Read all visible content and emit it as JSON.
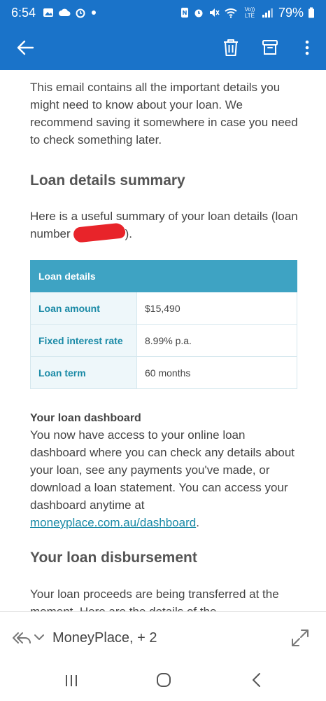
{
  "status_bar": {
    "time": "6:54",
    "left_icons": [
      "gallery-icon",
      "cloud-icon",
      "alarm-icon",
      "dot-icon"
    ],
    "right_icons": [
      "nfc-icon",
      "alarm-icon",
      "mute-icon",
      "wifi-icon",
      "volte-icon",
      "signal-icon"
    ],
    "volte_label": "Vo)) LTE",
    "battery": "79%"
  },
  "toolbar": {
    "back_icon": "back-arrow-icon",
    "delete_icon": "trash-icon",
    "archive_icon": "archive-icon",
    "more_icon": "more-vertical-icon"
  },
  "email": {
    "intro": "This email contains all the important details you might need to know about your loan. We recommend saving it somewhere in case you need to check something later.",
    "summary_heading": "Loan details summary",
    "summary_text_before": "Here is a useful summary of your loan details (loan number",
    "summary_text_after": ").",
    "table": {
      "header": "Loan details",
      "rows": [
        {
          "label": "Loan amount",
          "value": "$15,490"
        },
        {
          "label": "Fixed interest rate",
          "value": "8.99% p.a."
        },
        {
          "label": "Loan term",
          "value": "60 months"
        }
      ]
    },
    "dashboard_heading": "Your loan dashboard",
    "dashboard_text": "You now have access to your online loan dashboard where you can check any details about your loan, see any payments you've made, or download a loan statement. You can access your dashboard anytime at",
    "dashboard_link": "moneyplace.com.au/dashboard",
    "dashboard_link_suffix": ".",
    "disbursement_heading": "Your loan disbursement",
    "disbursement_text": "Your loan proceeds are being transferred at the moment. Here are the details of the"
  },
  "bottom_bar": {
    "sender": "MoneyPlace, + 2",
    "reply_icon": "reply-all-icon",
    "chevron_icon": "chevron-down-icon",
    "expand_icon": "expand-icon"
  },
  "nav_bar": {
    "recent_icon": "recent-apps-icon",
    "home_icon": "home-icon",
    "back_icon": "nav-back-icon"
  },
  "colors": {
    "app_bar": "#1a73c9",
    "table_header": "#3ea3c3",
    "table_label": "#1a8aa6",
    "redaction": "#e8242a"
  }
}
